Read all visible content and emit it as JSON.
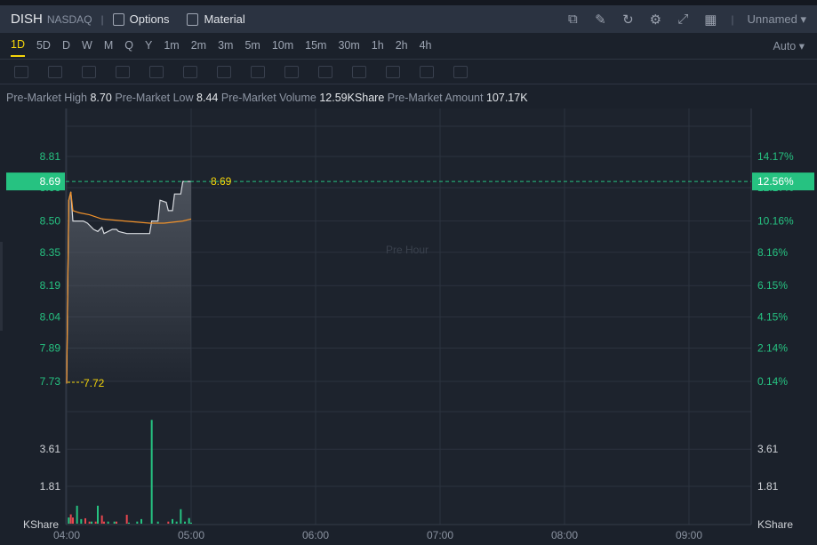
{
  "header": {
    "symbol": "DISH",
    "exchange": "NASDAQ",
    "options_label": "Options",
    "material_label": "Material",
    "layout_name": "Unnamed",
    "icons": [
      "chart-indicator-icon",
      "draw-icon",
      "refresh-icon",
      "settings-icon",
      "fullscreen-icon",
      "layout-grid-icon"
    ]
  },
  "timeframes": {
    "items": [
      "1D",
      "5D",
      "D",
      "W",
      "M",
      "Q",
      "Y",
      "1m",
      "2m",
      "3m",
      "5m",
      "10m",
      "15m",
      "30m",
      "1h",
      "2h",
      "4h"
    ],
    "active": "1D",
    "scale_mode": "Auto"
  },
  "drawing_tools": [
    "line-tool-icon",
    "rectangle-tool-icon",
    "pattern-tool-icon",
    "fib-tool-icon",
    "arrow-tool-icon",
    "measure-tool-icon",
    "text-tool-icon",
    "position-tool-icon",
    "pencil-icon",
    "lock-icon",
    "eye-icon",
    "magnet-icon",
    "copy-icon",
    "trash-icon"
  ],
  "info": {
    "high_label": "Pre-Market High",
    "high": "8.70",
    "low_label": "Pre-Market Low",
    "low": "8.44",
    "volume_label": "Pre-Market Volume",
    "volume": "12.59KShare",
    "amount_label": "Pre-Market Amount",
    "amount": "107.17K"
  },
  "colors": {
    "up": "#26c281",
    "down": "#e8474f",
    "price_line": "#d8dbe0",
    "avg_line": "#f0912a",
    "last_price": "#26c281",
    "label_yellow": "#f5d50a"
  },
  "chart_data": {
    "type": "line",
    "watermark": "Pre Hour",
    "x_ticks": [
      "04:00",
      "05:00",
      "06:00",
      "07:00",
      "08:00",
      "09:00"
    ],
    "xlim": [
      "04:00",
      "09:30"
    ],
    "price_ticks": [
      "8.81",
      "8.66",
      "8.50",
      "8.35",
      "8.19",
      "8.04",
      "7.89",
      "7.73"
    ],
    "pct_ticks": [
      "14.17%",
      "12.17%",
      "10.16%",
      "8.16%",
      "6.15%",
      "4.15%",
      "2.14%",
      "0.14%"
    ],
    "ylim": [
      7.73,
      8.81
    ],
    "last_price": "8.69",
    "last_pct": "12.56%",
    "low_marker": "7.72",
    "price": [
      [
        "04:00",
        7.72
      ],
      [
        "04:01",
        8.6
      ],
      [
        "04:02",
        8.64
      ],
      [
        "04:03",
        8.5
      ],
      [
        "04:08",
        8.5
      ],
      [
        "04:10",
        8.49
      ],
      [
        "04:13",
        8.46
      ],
      [
        "04:15",
        8.45
      ],
      [
        "04:17",
        8.47
      ],
      [
        "04:18",
        8.44
      ],
      [
        "04:20",
        8.45
      ],
      [
        "04:22",
        8.46
      ],
      [
        "04:24",
        8.46
      ],
      [
        "04:25",
        8.45
      ],
      [
        "04:29",
        8.44
      ],
      [
        "04:40",
        8.44
      ],
      [
        "04:41",
        8.5
      ],
      [
        "04:44",
        8.5
      ],
      [
        "04:45",
        8.6
      ],
      [
        "04:48",
        8.59
      ],
      [
        "04:49",
        8.55
      ],
      [
        "04:51",
        8.55
      ],
      [
        "04:52",
        8.63
      ],
      [
        "04:55",
        8.63
      ],
      [
        "04:56",
        8.69
      ],
      [
        "05:00",
        8.69
      ]
    ],
    "average": [
      [
        "04:00",
        7.72
      ],
      [
        "04:01",
        8.6
      ],
      [
        "04:02",
        8.64
      ],
      [
        "04:03",
        8.55
      ],
      [
        "04:06",
        8.54
      ],
      [
        "04:11",
        8.53
      ],
      [
        "04:17",
        8.51
      ],
      [
        "04:28",
        8.5
      ],
      [
        "04:40",
        8.49
      ],
      [
        "04:47",
        8.49
      ],
      [
        "04:56",
        8.5
      ],
      [
        "05:00",
        8.51
      ]
    ],
    "volume_unit": "KShare",
    "volume_ticks": [
      "3.61",
      "1.81"
    ],
    "volume_ylim": [
      0,
      5.2
    ],
    "volume": [
      [
        "04:01",
        0.3,
        "up"
      ],
      [
        "04:02",
        0.45,
        "down"
      ],
      [
        "04:03",
        0.3,
        "down"
      ],
      [
        "04:05",
        0.87,
        "up"
      ],
      [
        "04:07",
        0.22,
        "up"
      ],
      [
        "04:09",
        0.26,
        "down"
      ],
      [
        "04:11",
        0.1,
        "down"
      ],
      [
        "04:12",
        0.1,
        "up"
      ],
      [
        "04:14",
        0.1,
        "down"
      ],
      [
        "04:15",
        0.87,
        "up"
      ],
      [
        "04:17",
        0.4,
        "down"
      ],
      [
        "04:18",
        0.1,
        "down"
      ],
      [
        "04:20",
        0.1,
        "up"
      ],
      [
        "04:23",
        0.1,
        "up"
      ],
      [
        "04:24",
        0.1,
        "down"
      ],
      [
        "04:29",
        0.43,
        "down"
      ],
      [
        "04:30",
        0.05,
        "up"
      ],
      [
        "04:34",
        0.1,
        "up"
      ],
      [
        "04:36",
        0.22,
        "up"
      ],
      [
        "04:41",
        5.03,
        "up"
      ],
      [
        "04:44",
        0.1,
        "up"
      ],
      [
        "04:49",
        0.1,
        "down"
      ],
      [
        "04:51",
        0.22,
        "up"
      ],
      [
        "04:53",
        0.1,
        "up"
      ],
      [
        "04:55",
        0.7,
        "up"
      ],
      [
        "04:57",
        0.1,
        "up"
      ],
      [
        "04:59",
        0.27,
        "up"
      ],
      [
        "05:00",
        0.05,
        "up"
      ]
    ]
  }
}
